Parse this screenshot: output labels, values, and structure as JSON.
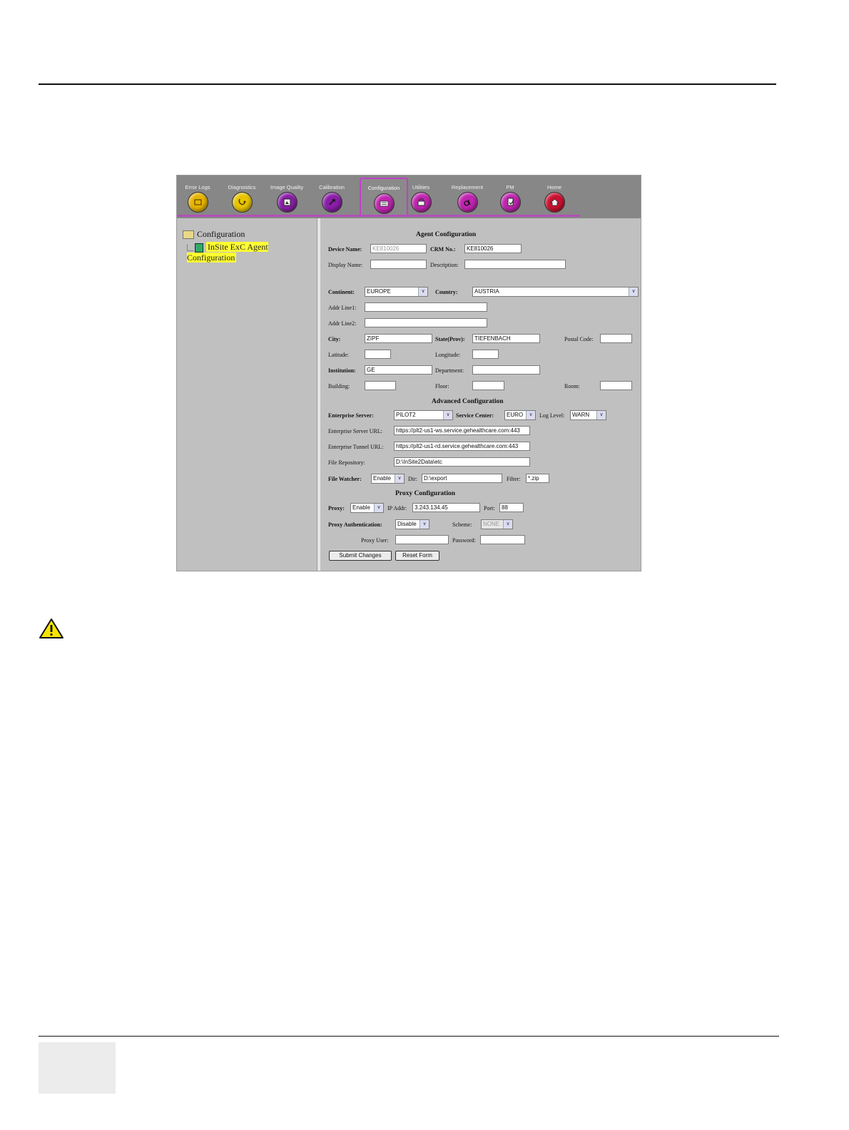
{
  "toolbar": {
    "items": [
      {
        "label": "Error Logs",
        "color": "#e8b400",
        "icon": "error-logs-icon"
      },
      {
        "label": "Diagnostics",
        "color": "#e8c400",
        "icon": "diagnostics-icon"
      },
      {
        "label": "Image Quality",
        "color": "#8a1ea8",
        "icon": "image-quality-icon"
      },
      {
        "label": "Calibration",
        "color": "#8a1ea8",
        "icon": "calibration-icon"
      },
      {
        "label": "Configuration",
        "color": "#c024b0",
        "icon": "configuration-icon"
      },
      {
        "label": "Utilities",
        "color": "#c024b0",
        "icon": "utilities-icon"
      },
      {
        "label": "Replacement",
        "color": "#c024b0",
        "icon": "replacement-icon"
      },
      {
        "label": "PM",
        "color": "#c024b0",
        "icon": "pm-icon"
      },
      {
        "label": "Home",
        "color": "#cc1030",
        "icon": "home-icon"
      }
    ]
  },
  "tree": {
    "root": "Configuration",
    "child": "InSite ExC Agent Configuration"
  },
  "form": {
    "title": "Agent Configuration",
    "device_name_label": "Device Name:",
    "device_name_value": "KE810026",
    "crm_label": "CRM No.:",
    "crm_value": "KE810026",
    "display_name_label": "Display Name:",
    "description_label": "Description:",
    "continent_label": "Continent:",
    "continent_value": "EUROPE",
    "country_label": "Country:",
    "country_value": "AUSTRIA",
    "addr1_label": "Addr Line1:",
    "addr2_label": "Addr Line2:",
    "city_label": "City:",
    "city_value": "ZIPF",
    "state_label": "State(Prov):",
    "state_value": "TIEFENBACH",
    "postal_label": "Postal Code:",
    "latitude_label": "Latitude:",
    "longitude_label": "Longitude:",
    "institution_label": "Institution:",
    "institution_value": "GE",
    "department_label": "Department:",
    "building_label": "Building:",
    "floor_label": "Floor:",
    "room_label": "Room:",
    "advanced_title": "Advanced Configuration",
    "ent_server_label": "Enterprise Server:",
    "ent_server_value": "PILOT2",
    "service_center_label": "Service Center:",
    "service_center_value": "EURO",
    "log_level_label": "Log Level:",
    "log_level_value": "WARN",
    "ent_server_url_label": "Enterprise Server URL:",
    "ent_server_url_value": "https://plt2-us1-ws.service.gehealthcare.com:443",
    "ent_tunnel_url_label": "Enterprise Tunnel URL:",
    "ent_tunnel_url_value": "https://plt2-us1-rd.service.gehealthcare.com:443",
    "file_repo_label": "File Repository:",
    "file_repo_value": "D:\\InSite2Data\\etc",
    "file_watcher_label": "File Watcher:",
    "file_watcher_value": "Enable",
    "dir_label": "Dir:",
    "dir_value": "D:\\export",
    "filter_label": "Filter:",
    "filter_value": "*.zip",
    "proxy_title": "Proxy Configuration",
    "proxy_label": "Proxy:",
    "proxy_value": "Enable",
    "ip_label": "IP Addr:",
    "ip_value": "3.243.134.45",
    "port_label": "Port:",
    "port_value": "88",
    "proxy_auth_label": "Proxy Authentication:",
    "proxy_auth_value": "Disable",
    "scheme_label": "Scheme:",
    "scheme_value": "NONE",
    "proxy_user_label": "Proxy User:",
    "password_label": "Password:",
    "submit_label": "Submit Changes",
    "reset_label": "Reset Form"
  }
}
